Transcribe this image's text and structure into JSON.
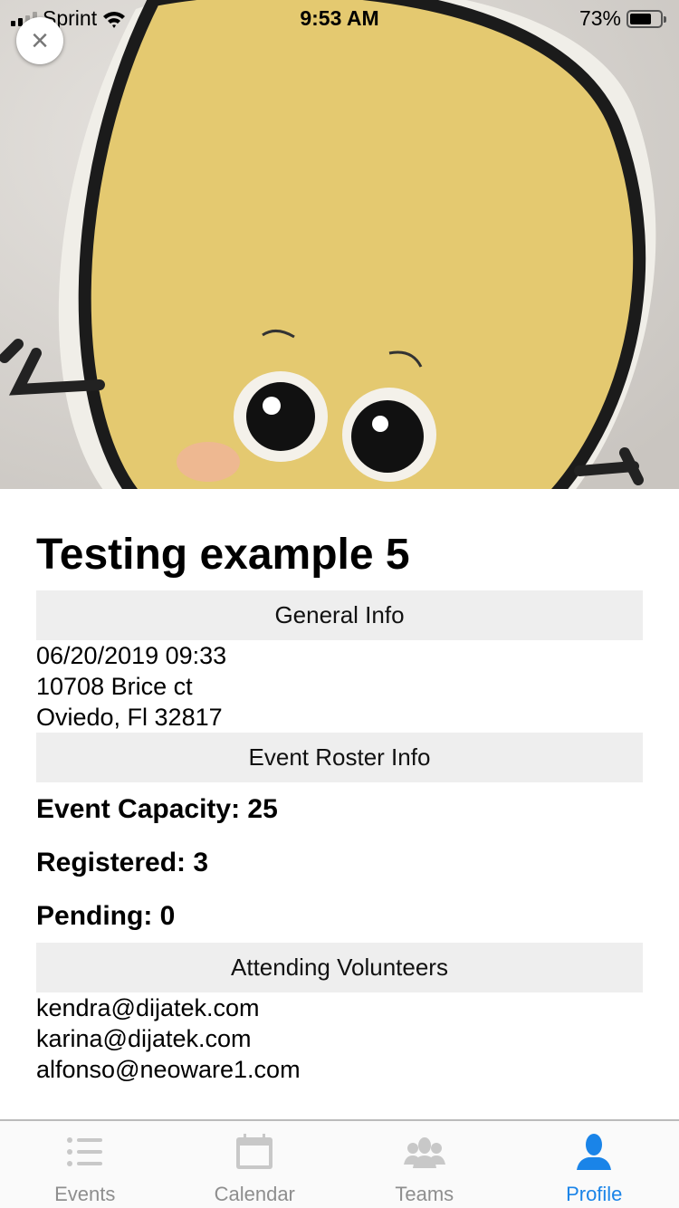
{
  "status_bar": {
    "carrier": "Sprint",
    "time": "9:53 AM",
    "battery": "73%",
    "battery_level": 0.73
  },
  "event": {
    "title": "Testing example 5",
    "general_info_header": "General Info",
    "datetime": "06/20/2019 09:33",
    "address_line1": "10708 Brice ct",
    "address_line2": "Oviedo, Fl  32817",
    "roster_header": "Event Roster Info",
    "capacity": "Event Capacity: 25",
    "registered": "Registered: 3",
    "pending": "Pending: 0",
    "volunteers_header": "Attending Volunteers",
    "volunteers": [
      "kendra@dijatek.com",
      "karina@dijatek.com",
      "alfonso@neoware1.com"
    ]
  },
  "close_icon": "×",
  "tabs": [
    {
      "label": "Events",
      "icon": "list-icon"
    },
    {
      "label": "Calendar",
      "icon": "calendar-icon"
    },
    {
      "label": "Teams",
      "icon": "team-icon"
    },
    {
      "label": "Profile",
      "icon": "person-icon"
    }
  ],
  "colors": {
    "accent": "#1a84e8",
    "inactive": "#8e8e8e",
    "section_bg": "#eeeeee"
  }
}
